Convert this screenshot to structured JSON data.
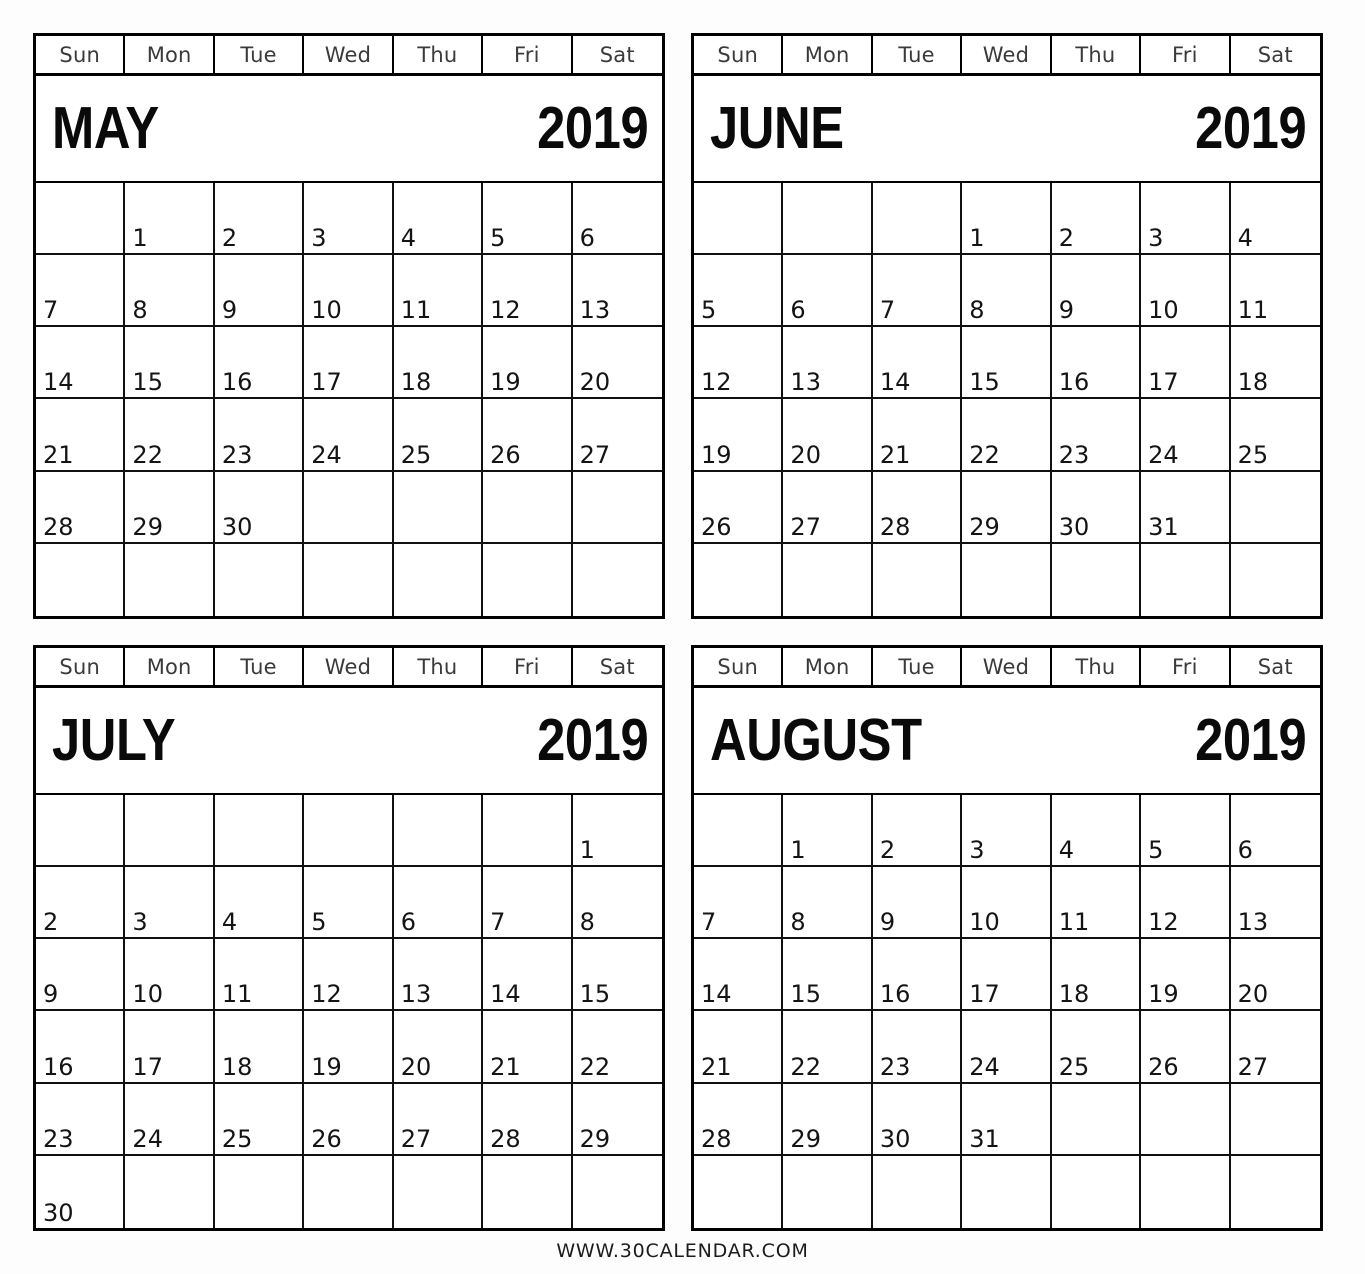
{
  "site": {
    "footer_text": "WWW.30CALENDAR.COM"
  },
  "weekday_headers": [
    "Sun",
    "Mon",
    "Tue",
    "Wed",
    "Thu",
    "Fri",
    "Sat"
  ],
  "colors": {
    "background": "#ffffff",
    "border": "#000000",
    "text": "#141414",
    "weekday_text": "#3a3a3a"
  },
  "months": [
    {
      "name": "MAY",
      "year": "2019",
      "first_day_column": 1,
      "days_in_month": 30,
      "weeks": [
        [
          "",
          "1",
          "2",
          "3",
          "4",
          "5",
          "6"
        ],
        [
          "7",
          "8",
          "9",
          "10",
          "11",
          "12",
          "13"
        ],
        [
          "14",
          "15",
          "16",
          "17",
          "18",
          "19",
          "20"
        ],
        [
          "21",
          "22",
          "23",
          "24",
          "25",
          "26",
          "27"
        ],
        [
          "28",
          "29",
          "30",
          "",
          "",
          "",
          ""
        ],
        [
          "",
          "",
          "",
          "",
          "",
          "",
          ""
        ]
      ]
    },
    {
      "name": "JUNE",
      "year": "2019",
      "first_day_column": 3,
      "days_in_month": 31,
      "weeks": [
        [
          "",
          "",
          "",
          "1",
          "2",
          "3",
          "4"
        ],
        [
          "5",
          "6",
          "7",
          "8",
          "9",
          "10",
          "11"
        ],
        [
          "12",
          "13",
          "14",
          "15",
          "16",
          "17",
          "18"
        ],
        [
          "19",
          "20",
          "21",
          "22",
          "23",
          "24",
          "25"
        ],
        [
          "26",
          "27",
          "28",
          "29",
          "30",
          "31",
          ""
        ],
        [
          "",
          "",
          "",
          "",
          "",
          "",
          ""
        ]
      ]
    },
    {
      "name": "JULY",
      "year": "2019",
      "first_day_column": 6,
      "days_in_month": 30,
      "weeks": [
        [
          "",
          "",
          "",
          "",
          "",
          "",
          "1"
        ],
        [
          "2",
          "3",
          "4",
          "5",
          "6",
          "7",
          "8"
        ],
        [
          "9",
          "10",
          "11",
          "12",
          "13",
          "14",
          "15"
        ],
        [
          "16",
          "17",
          "18",
          "19",
          "20",
          "21",
          "22"
        ],
        [
          "23",
          "24",
          "25",
          "26",
          "27",
          "28",
          "29"
        ],
        [
          "30",
          "",
          "",
          "",
          "",
          "",
          ""
        ]
      ]
    },
    {
      "name": "AUGUST",
      "year": "2019",
      "first_day_column": 1,
      "days_in_month": 31,
      "weeks": [
        [
          "",
          "1",
          "2",
          "3",
          "4",
          "5",
          "6"
        ],
        [
          "7",
          "8",
          "9",
          "10",
          "11",
          "12",
          "13"
        ],
        [
          "14",
          "15",
          "16",
          "17",
          "18",
          "19",
          "20"
        ],
        [
          "21",
          "22",
          "23",
          "24",
          "25",
          "26",
          "27"
        ],
        [
          "28",
          "29",
          "30",
          "31",
          "",
          "",
          ""
        ],
        [
          "",
          "",
          "",
          "",
          "",
          "",
          ""
        ]
      ]
    }
  ]
}
